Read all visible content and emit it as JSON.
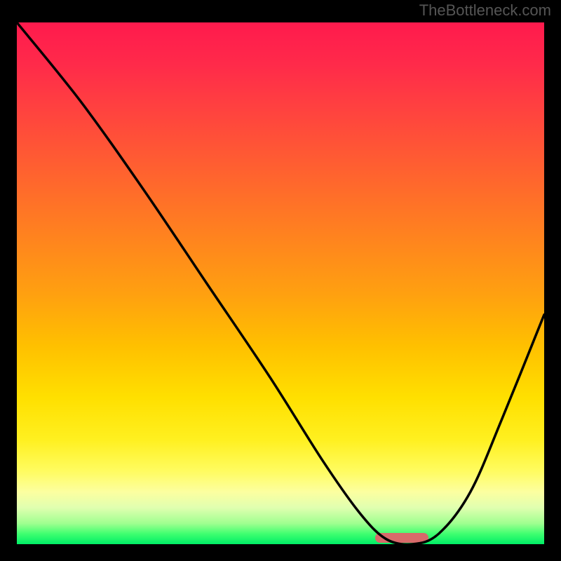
{
  "watermark": "TheBottleneck.com",
  "chart_data": {
    "type": "line",
    "title": "",
    "xlabel": "",
    "ylabel": "",
    "xlim": [
      0,
      100
    ],
    "ylim": [
      0,
      100
    ],
    "grid": false,
    "series": [
      {
        "name": "bottleneck-curve",
        "x": [
          0,
          12,
          24,
          36,
          48,
          58,
          65,
          70,
          75,
          80,
          86,
          92,
          100
        ],
        "y": [
          100,
          85,
          68,
          50,
          32,
          16,
          6,
          1,
          0,
          2,
          10,
          24,
          44
        ]
      }
    ],
    "markers": [
      {
        "name": "optimal-zone",
        "x_start": 68,
        "x_end": 78,
        "y": 0
      }
    ],
    "colors": {
      "line": "#000000",
      "marker": "#d86a6a",
      "gradient_top": "#ff1a4d",
      "gradient_bottom": "#00ee66"
    }
  }
}
